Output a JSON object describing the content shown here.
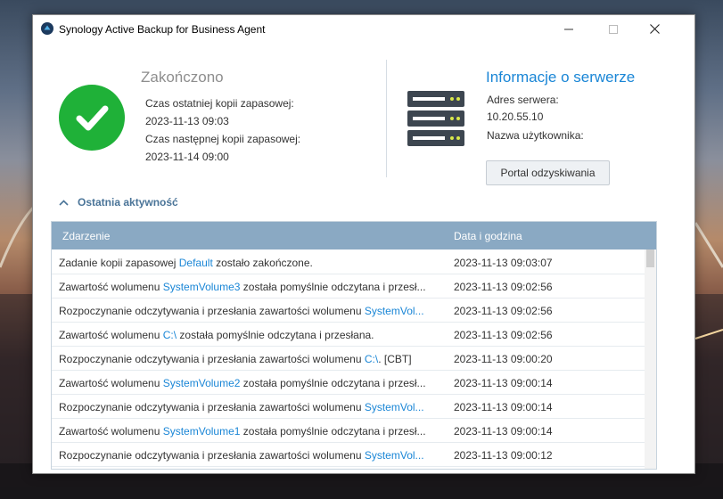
{
  "window": {
    "title": "Synology Active Backup for Business Agent"
  },
  "status": {
    "title": "Zakończono",
    "last_backup_label": "Czas ostatniej kopii zapasowej:",
    "last_backup_value": "2023-11-13 09:03",
    "next_backup_label": "Czas następnej kopii zapasowej:",
    "next_backup_value": "2023-11-14 09:00"
  },
  "server": {
    "title": "Informacje o serwerze",
    "address_label": "Adres serwera:",
    "address_value": "10.20.55.10",
    "username_label": "Nazwa użytkownika:",
    "portal_button": "Portal odzyskiwania"
  },
  "activity": {
    "toggle_label": "Ostatnia aktywność",
    "columns": {
      "event": "Zdarzenie",
      "date": "Data i godzina"
    },
    "rows": [
      {
        "pre": "Zadanie kopii zapasowej ",
        "link": "Default",
        "post": " zostało zakończone.",
        "date": "2023-11-13 09:03:07"
      },
      {
        "pre": "Zawartość wolumenu ",
        "link": "SystemVolume3",
        "post": " została pomyślnie odczytana i przesł...",
        "date": "2023-11-13 09:02:56"
      },
      {
        "pre": "Rozpoczynanie odczytywania i przesłania zawartości wolumenu ",
        "link": "SystemVol...",
        "post": "",
        "date": "2023-11-13 09:02:56"
      },
      {
        "pre": "Zawartość wolumenu ",
        "link": "C:\\",
        "post": " została pomyślnie odczytana i przesłana.",
        "date": "2023-11-13 09:02:56"
      },
      {
        "pre": "Rozpoczynanie odczytywania i przesłania zawartości wolumenu ",
        "link": "C:\\",
        "post": ". [CBT]",
        "date": "2023-11-13 09:00:20"
      },
      {
        "pre": "Zawartość wolumenu ",
        "link": "SystemVolume2",
        "post": " została pomyślnie odczytana i przesł...",
        "date": "2023-11-13 09:00:14"
      },
      {
        "pre": "Rozpoczynanie odczytywania i przesłania zawartości wolumenu ",
        "link": "SystemVol...",
        "post": "",
        "date": "2023-11-13 09:00:14"
      },
      {
        "pre": "Zawartość wolumenu ",
        "link": "SystemVolume1",
        "post": " została pomyślnie odczytana i przesł...",
        "date": "2023-11-13 09:00:14"
      },
      {
        "pre": "Rozpoczynanie odczytywania i przesłania zawartości wolumenu ",
        "link": "SystemVol...",
        "post": "",
        "date": "2023-11-13 09:00:12"
      }
    ]
  },
  "colors": {
    "accent": "#1a86d6",
    "success": "#1fb138",
    "table_header": "#8aa9c3"
  }
}
